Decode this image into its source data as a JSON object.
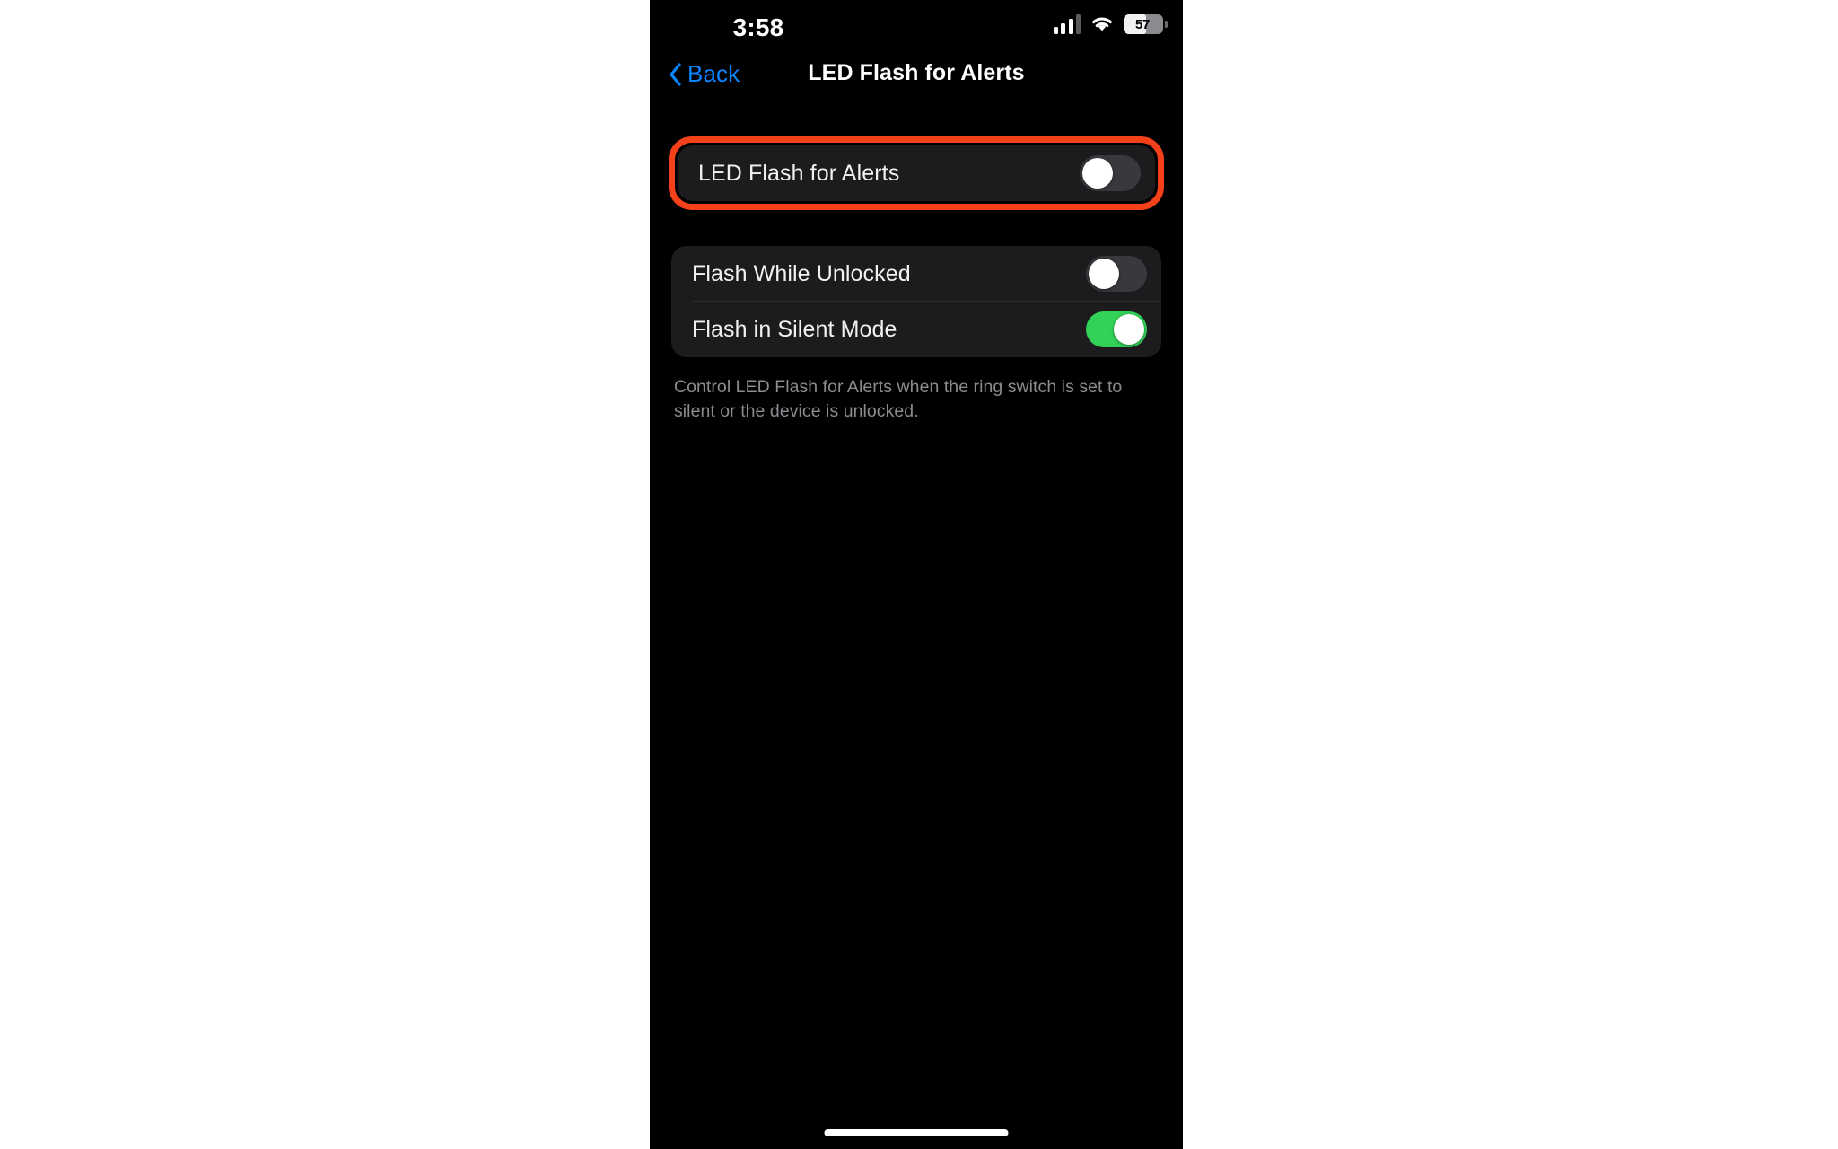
{
  "statusbar": {
    "time": "3:58",
    "cellular_icon": "cellular-signal-icon",
    "wifi_icon": "wifi-icon",
    "battery_icon": "battery-icon",
    "battery_percent": "57",
    "battery_level_pct": 57
  },
  "navbar": {
    "back_icon": "chevron-left-icon",
    "back_label": "Back",
    "title": "LED Flash for Alerts"
  },
  "colors": {
    "accent_blue": "#0a84ff",
    "toggle_on_green": "#32d158",
    "toggle_off_track": "#39393d",
    "highlight_red": "#f4411a",
    "card_bg": "#1c1c1e",
    "screen_bg": "#000000",
    "footnote_gray": "#8b8b90"
  },
  "main": {
    "primary_group": {
      "highlighted": true,
      "rows": [
        {
          "label": "LED Flash for Alerts",
          "toggle": "off"
        }
      ]
    },
    "secondary_group": {
      "rows": [
        {
          "label": "Flash While Unlocked",
          "toggle": "off"
        },
        {
          "label": "Flash in Silent Mode",
          "toggle": "on"
        }
      ]
    },
    "footnote": "Control LED Flash for Alerts when the ring switch is set to silent or the device is unlocked."
  },
  "home_indicator": "home-indicator"
}
